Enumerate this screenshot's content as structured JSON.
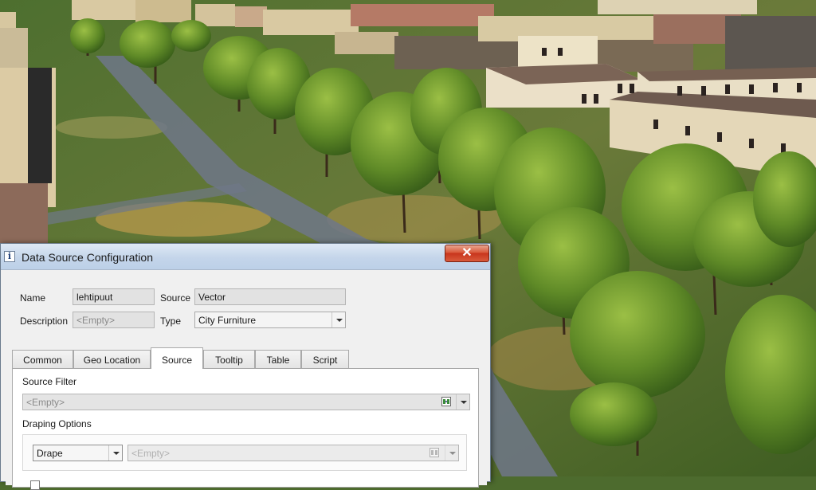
{
  "scene": {
    "icons": {
      "trees": "deciduous-tree-icon",
      "buildings": "building-icon"
    }
  },
  "dialog": {
    "title": "Data Source Configuration",
    "close_symbol": "✕",
    "icons": {
      "app": "info-i-icon",
      "close": "close-icon",
      "filter": "filter-icon",
      "dropdown": "chevron-down-icon"
    },
    "name_label": "Name",
    "name_value": "lehtipuut",
    "source_label": "Source",
    "source_value": "Vector",
    "description_label": "Description",
    "description_placeholder": "<Empty>",
    "type_label": "Type",
    "type_value": "City Furniture",
    "tabs": [
      {
        "label": "Common"
      },
      {
        "label": "Geo Location"
      },
      {
        "label": "Source"
      },
      {
        "label": "Tooltip"
      },
      {
        "label": "Table"
      },
      {
        "label": "Script"
      }
    ],
    "active_tab": "Source",
    "source_filter_label": "Source Filter",
    "source_filter_placeholder": "<Empty>",
    "draping_label": "Draping Options",
    "draping_mode": "Drape",
    "draping_target_placeholder": "<Empty>"
  }
}
